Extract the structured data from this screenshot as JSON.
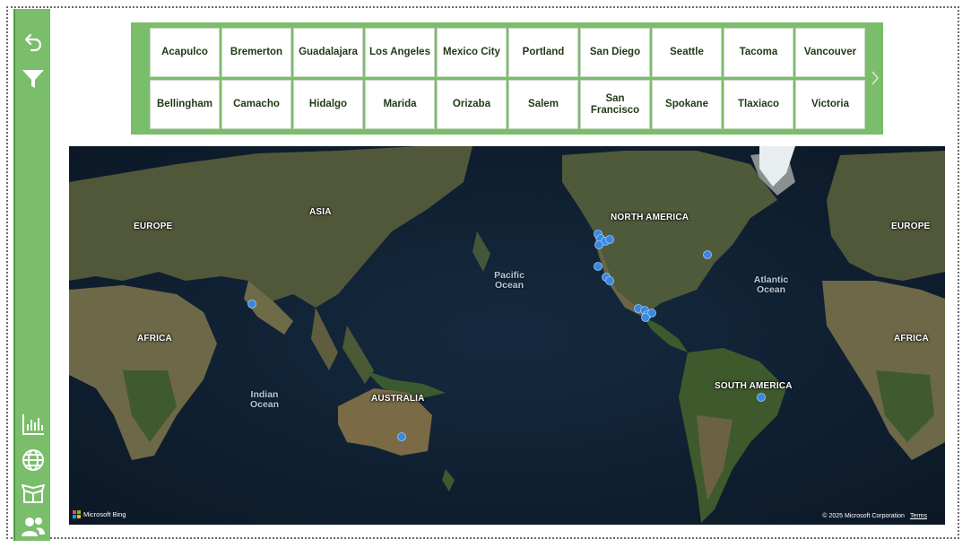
{
  "sidebar": {
    "top_icons": [
      "back-icon",
      "filter-icon"
    ],
    "bottom_icons": [
      "bar-chart-icon",
      "globe-icon",
      "box-icon",
      "people-icon"
    ]
  },
  "slicer": {
    "row1": [
      "Acapulco",
      "Bremerton",
      "Guadalajara",
      "Los Angeles",
      "Mexico City",
      "Portland",
      "San Diego",
      "Seattle",
      "Tacoma",
      "Vancouver"
    ],
    "row2": [
      "Bellingham",
      "Camacho",
      "Hidalgo",
      "Marida",
      "Orizaba",
      "Salem",
      "San Francisco",
      "Spokane",
      "Tlaxiaco",
      "Victoria"
    ]
  },
  "map": {
    "labels": {
      "europe_left": "EUROPE",
      "asia": "ASIA",
      "north_america": "NORTH AMERICA",
      "europe_right": "EUROPE",
      "africa_left": "AFRICA",
      "africa_right": "AFRICA",
      "australia": "AUSTRALIA",
      "south_america": "SOUTH AMERICA",
      "pacific_ocean": "Pacific Ocean",
      "atlantic_ocean": "Atlantic Ocean",
      "indian_ocean": "Indian Ocean"
    },
    "attribution": "Microsoft Bing",
    "copyright": "© 2025 Microsoft Corporation",
    "terms": "Terms"
  },
  "colors": {
    "accent_green": "#7abd6a",
    "marker_blue": "#3a87e0"
  }
}
